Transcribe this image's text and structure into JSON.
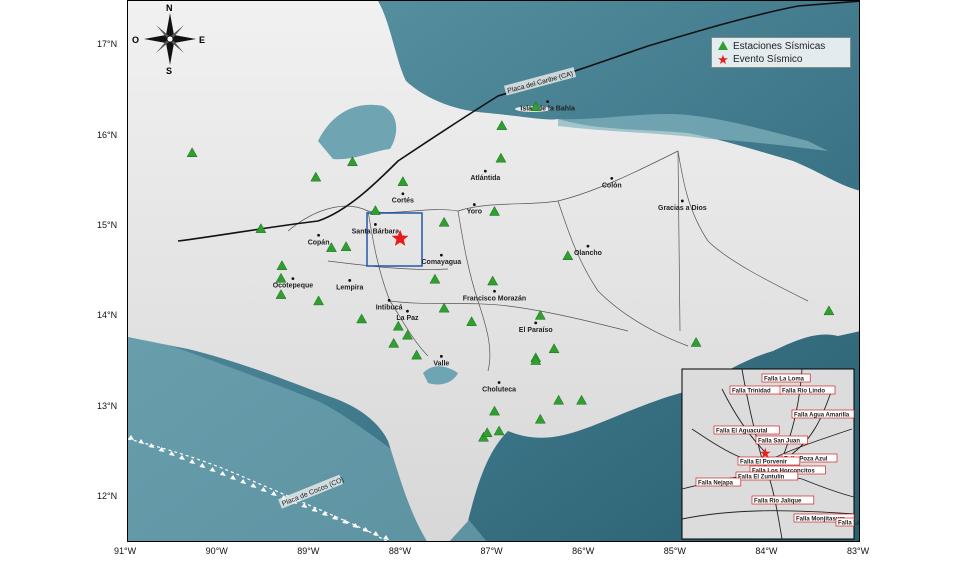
{
  "compass": {
    "n": "N",
    "s": "S",
    "e": "E",
    "o": "O"
  },
  "legend": {
    "stations_label": "Estaciones Sísmicas",
    "event_label": "Evento Sísmico",
    "station_color": "#2fa02f",
    "event_color": "#e81b1b"
  },
  "axes": {
    "x_ticks": [
      "91°W",
      "90°W",
      "89°W",
      "88°W",
      "87°W",
      "86°W",
      "85°W",
      "84°W",
      "83°W"
    ],
    "y_ticks": [
      "17°N",
      "16°N",
      "15°N",
      "14°N",
      "13°N",
      "12°N"
    ]
  },
  "plates": {
    "caribe": "Placa del Caribe (CA)",
    "cocos": "Placa de Cocos (CO)"
  },
  "places": [
    {
      "name": "Islas de la Bahía",
      "lon": -86.42,
      "lat": 16.32
    },
    {
      "name": "Atlántida",
      "lon": -87.1,
      "lat": 15.55
    },
    {
      "name": "Colón",
      "lon": -85.72,
      "lat": 15.47
    },
    {
      "name": "Gracias a Dios",
      "lon": -84.95,
      "lat": 15.22
    },
    {
      "name": "Cortés",
      "lon": -88.0,
      "lat": 15.3
    },
    {
      "name": "Yoro",
      "lon": -87.22,
      "lat": 15.18
    },
    {
      "name": "Santa Bárbara",
      "lon": -88.3,
      "lat": 14.96
    },
    {
      "name": "Copán",
      "lon": -88.92,
      "lat": 14.84
    },
    {
      "name": "Olancho",
      "lon": -85.98,
      "lat": 14.72
    },
    {
      "name": "Comayagua",
      "lon": -87.58,
      "lat": 14.62
    },
    {
      "name": "Ocotepeque",
      "lon": -89.2,
      "lat": 14.36
    },
    {
      "name": "Lempira",
      "lon": -88.58,
      "lat": 14.34
    },
    {
      "name": "Francisco Morazán",
      "lon": -87.0,
      "lat": 14.22
    },
    {
      "name": "Intibucá",
      "lon": -88.15,
      "lat": 14.12
    },
    {
      "name": "La Paz",
      "lon": -87.95,
      "lat": 14.0
    },
    {
      "name": "El Paraíso",
      "lon": -86.55,
      "lat": 13.87
    },
    {
      "name": "Valle",
      "lon": -87.58,
      "lat": 13.5
    },
    {
      "name": "Choluteca",
      "lon": -86.95,
      "lat": 13.21
    }
  ],
  "inset": {
    "faults": [
      "Falla La Loma",
      "Falla Trinidad",
      "Falla Río Lindo",
      "Falla Agua Amarilla",
      "Falla El Aguacutal",
      "Falla San Juan",
      "Falla Poza Azul",
      "Falla El Porvenir",
      "Falla Los Horconcitos",
      "Falla El Zuntulín",
      "Falla Nejapa",
      "Falla Río Jalique",
      "Falla Monjitasura",
      "Falla La Ca"
    ]
  },
  "chart_data": {
    "type": "scatter",
    "xlim": [
      -91.0,
      -83.0
    ],
    "ylim": [
      11.5,
      17.5
    ],
    "series": [
      {
        "name": "Estaciones Sísmicas",
        "marker": "triangle",
        "color": "#2fa02f",
        "x": [
          -90.3,
          -88.55,
          -88.95,
          -88.0,
          -87.55,
          -87.65,
          -88.3,
          -89.55,
          -89.32,
          -89.33,
          -89.33,
          -88.92,
          -88.78,
          -88.62,
          -88.45,
          -88.05,
          -87.95,
          -88.1,
          -87.85,
          -87.55,
          -87.25,
          -87.02,
          -87.0,
          -86.93,
          -86.92,
          -86.55,
          -86.5,
          -86.55,
          -86.3,
          -86.5,
          -86.35,
          -86.05,
          -86.55,
          -87.0,
          -87.12,
          -87.08,
          -86.95,
          -84.8,
          -83.35,
          -86.2
        ],
        "y": [
          15.82,
          15.72,
          15.55,
          15.5,
          15.05,
          14.42,
          15.18,
          14.98,
          14.57,
          14.43,
          14.25,
          14.18,
          14.77,
          14.78,
          13.98,
          13.9,
          13.8,
          13.71,
          13.58,
          14.1,
          13.95,
          14.4,
          15.17,
          15.76,
          16.12,
          16.33,
          14.02,
          13.55,
          13.08,
          12.87,
          13.65,
          13.08,
          13.52,
          12.96,
          12.67,
          12.72,
          12.74,
          13.72,
          14.07,
          14.68
        ]
      },
      {
        "name": "Evento Sísmico",
        "marker": "star",
        "color": "#e81b1b",
        "x": [
          -88.03
        ],
        "y": [
          14.87
        ]
      }
    ]
  }
}
